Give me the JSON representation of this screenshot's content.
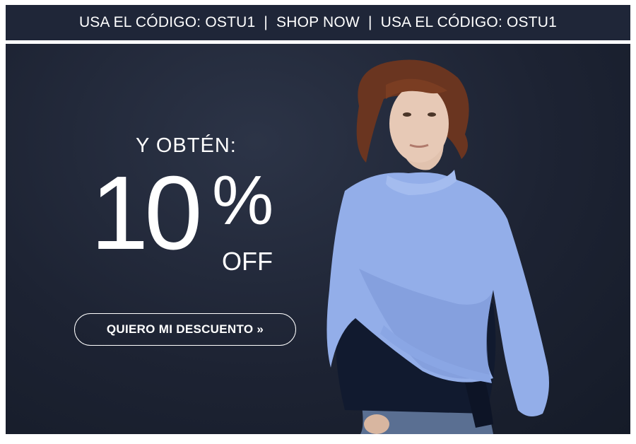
{
  "promo_bar": {
    "left_text": "USA EL CÓDIGO: OSTU1",
    "separator": "|",
    "shop_now": "SHOP NOW",
    "right_text": "USA EL CÓDIGO: OSTU1"
  },
  "hero": {
    "kicker": "Y OBTÉN:",
    "discount_number": "10",
    "discount_percent": "%",
    "discount_off": "OFF",
    "cta_label": "QUIERO MI DESCUENTO »"
  },
  "colors": {
    "promo_bar_bg": "#1f2638",
    "hero_bg": "#1d2333",
    "sweater_blue": "#93aee9",
    "text": "#ffffff"
  }
}
